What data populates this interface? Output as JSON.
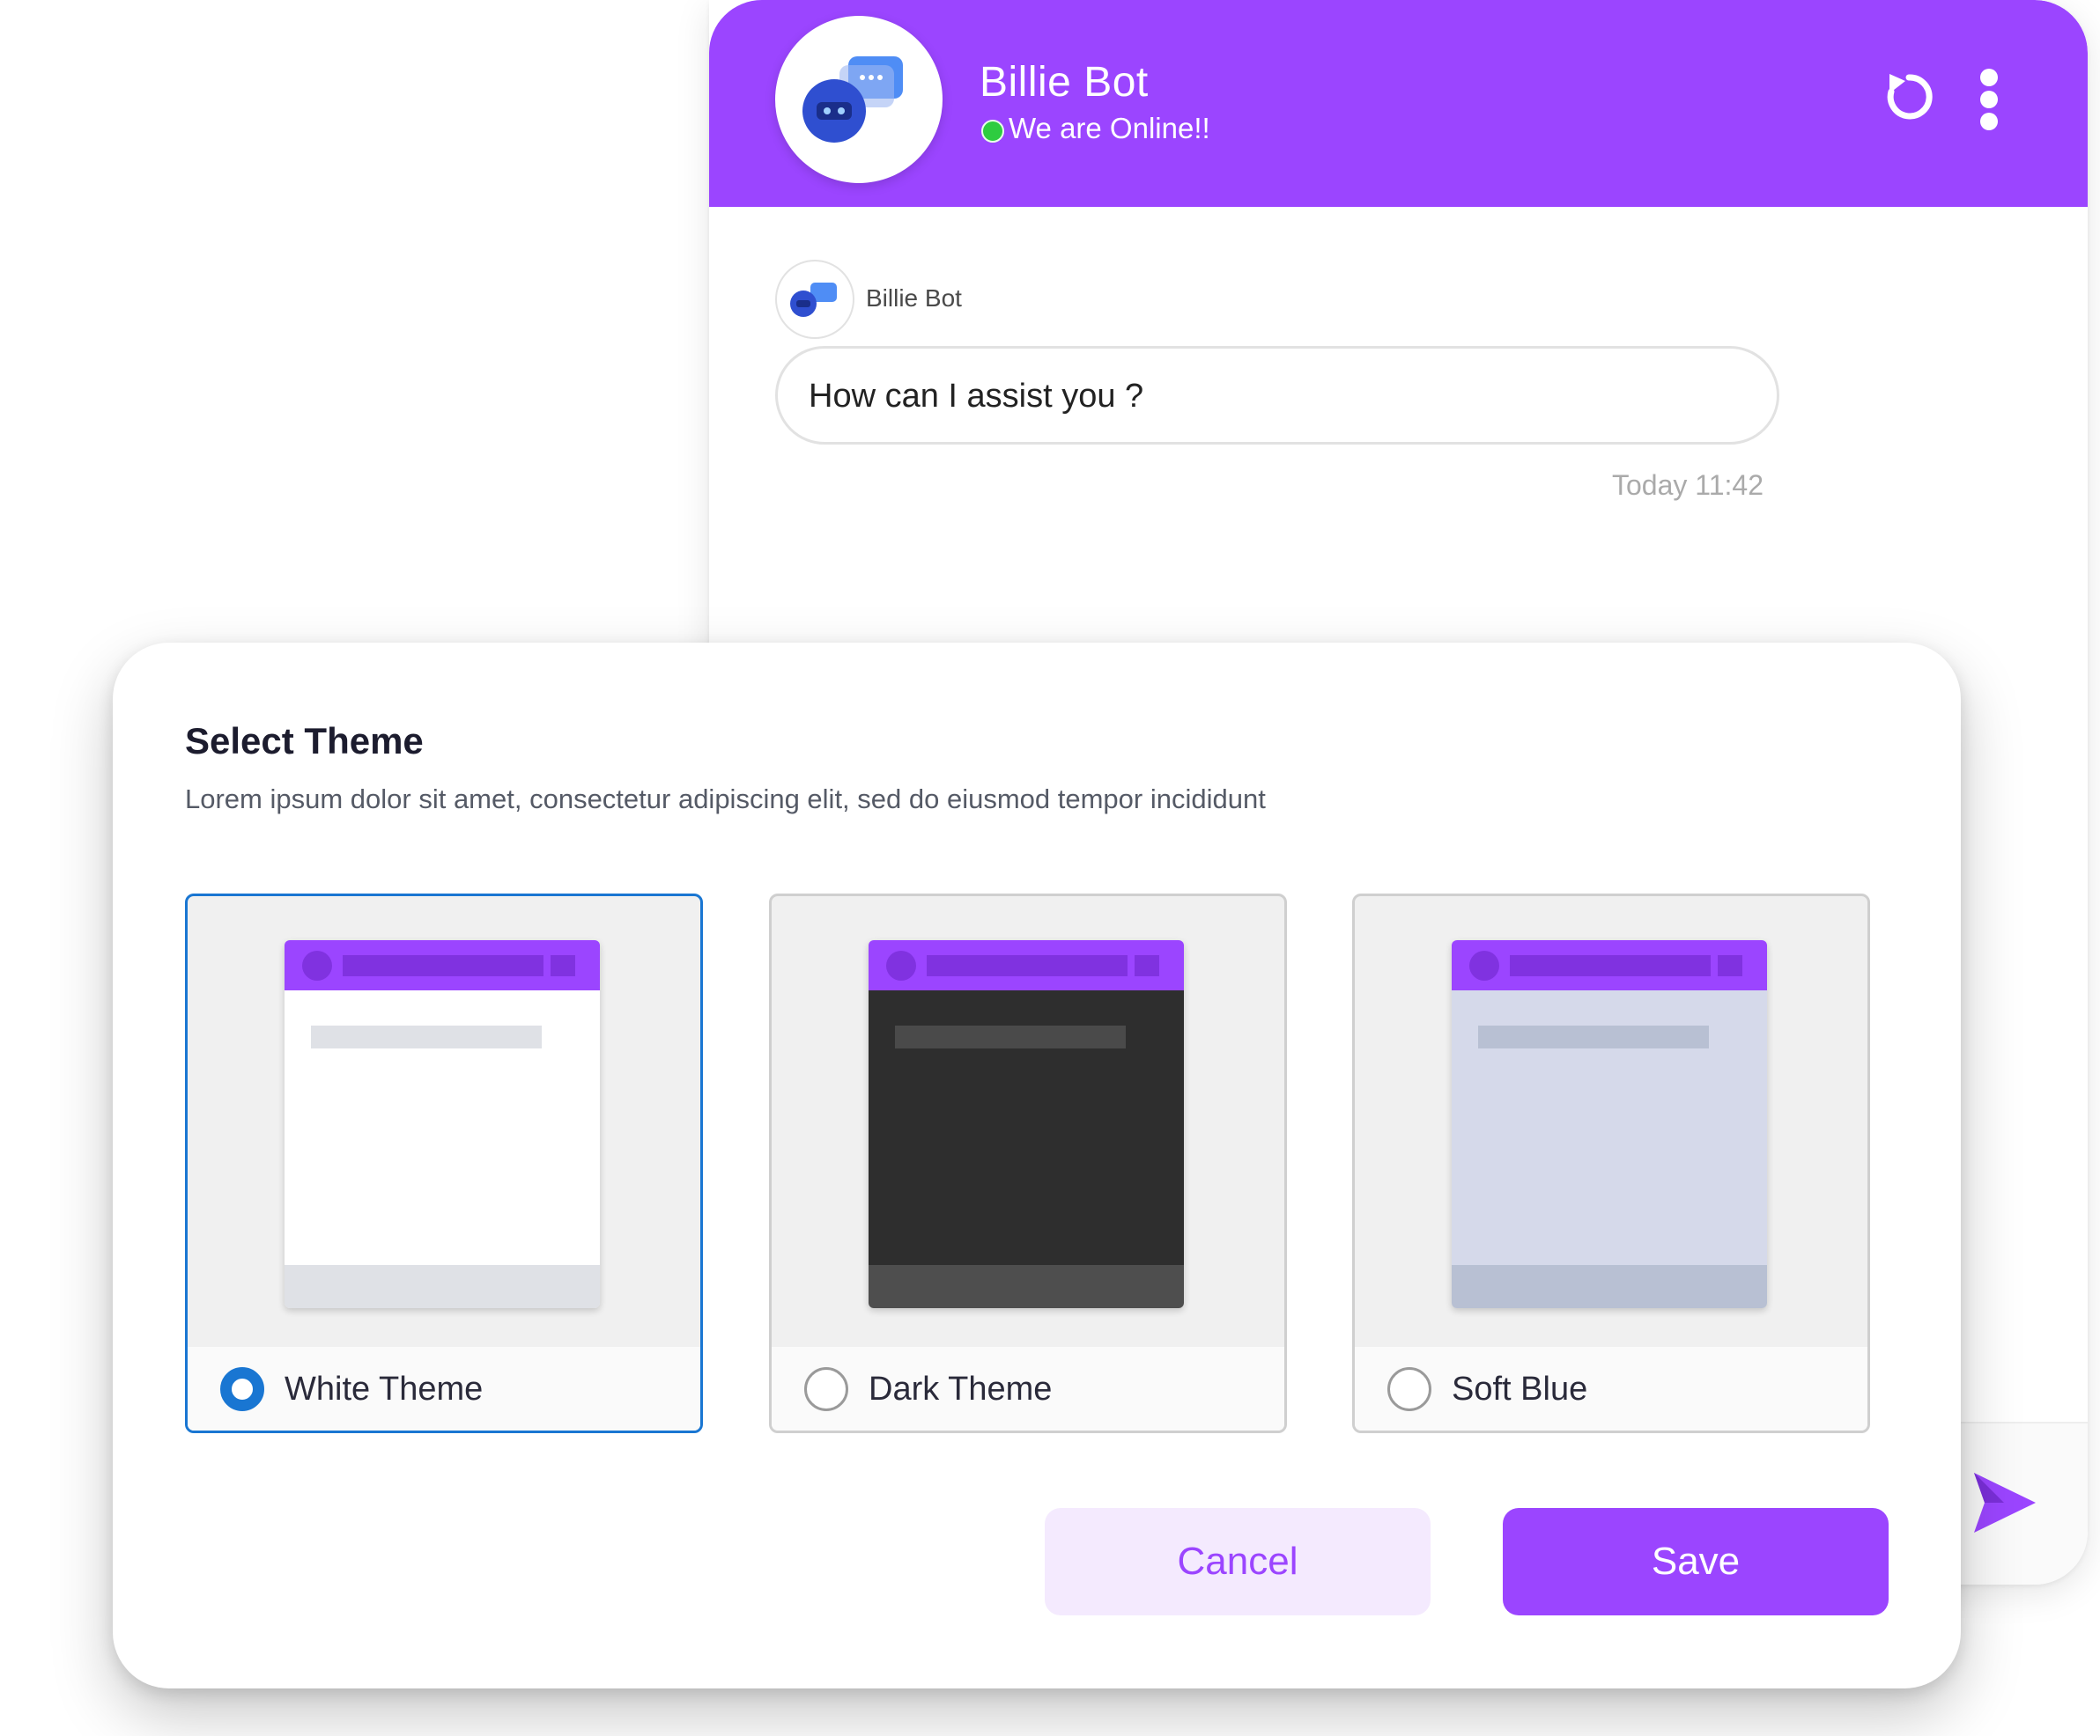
{
  "colors": {
    "brand": "#9b45ff",
    "online": "#2ecc40",
    "selected": "#1976d2"
  },
  "chat": {
    "bot_name": "Billie Bot",
    "status": "We are Online!!",
    "message": {
      "sender": "Billie Bot",
      "text": "How can I assist you ?",
      "time": "Today 11:42"
    },
    "icons": {
      "refresh": "refresh-icon",
      "menu": "more-vertical-icon",
      "send": "send-icon"
    }
  },
  "modal": {
    "title": "Select Theme",
    "description": "Lorem ipsum dolor sit amet, consectetur adipiscing elit, sed do eiusmod tempor incididunt",
    "themes": [
      {
        "label": "White Theme",
        "selected": true,
        "body": "#ffffff",
        "line": "#dfe1e6",
        "foot": "#dfe1e6"
      },
      {
        "label": "Dark Theme",
        "selected": false,
        "body": "#2e2e2e",
        "line": "#4a4a4a",
        "foot": "#4e4e4e"
      },
      {
        "label": "Soft Blue",
        "selected": false,
        "body": "#d5d9ea",
        "line": "#b8c0d3",
        "foot": "#b8c0d3"
      }
    ],
    "cancel_label": "Cancel",
    "save_label": "Save"
  }
}
